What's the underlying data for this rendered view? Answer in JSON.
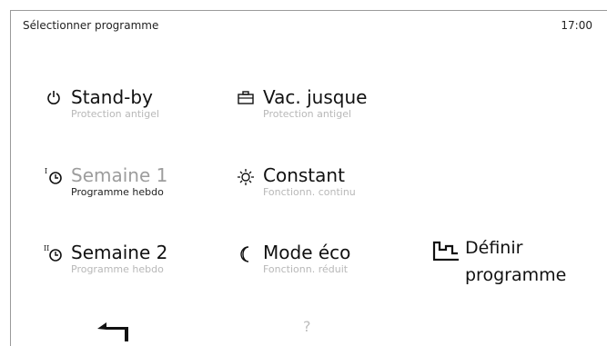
{
  "header": {
    "title": "Sélectionner programme",
    "time": "17:00"
  },
  "programs": {
    "standby": {
      "icon": "power-icon",
      "title": "Stand-by",
      "subtitle": "Protection antigel"
    },
    "vacation": {
      "icon": "suitcase-icon",
      "title": "Vac. jusque",
      "subtitle": "Protection antigel"
    },
    "week1": {
      "icon": "clock-1-icon",
      "title": "Semaine 1",
      "subtitle": "Programme hebdo"
    },
    "constant": {
      "icon": "sun-icon",
      "title": "Constant",
      "subtitle": "Fonctionn. continu"
    },
    "week2": {
      "icon": "clock-2-icon",
      "title": "Semaine 2",
      "subtitle": "Programme hebdo"
    },
    "eco": {
      "icon": "moon-icon",
      "title": "Mode éco",
      "subtitle": "Fonctionn. réduit"
    }
  },
  "define": {
    "icon": "schedule-graph-icon",
    "label_line1": "Définir",
    "label_line2": "programme"
  },
  "footer": {
    "back_icon": "back-arrow-icon",
    "help": "?"
  }
}
